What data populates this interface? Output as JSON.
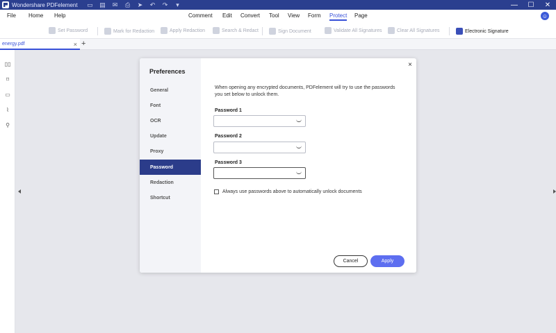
{
  "app": {
    "title": "Wondershare PDFelement"
  },
  "quick_access": [
    "folder-icon",
    "save-icon",
    "mail-icon",
    "print-icon",
    "send-icon",
    "undo-icon",
    "redo-icon",
    "dropdown-icon"
  ],
  "window_controls": {
    "minimize": "—",
    "maximize": "☐",
    "close": "✕"
  },
  "menu": {
    "file": "File",
    "home": "Home",
    "help": "Help",
    "comment": "Comment",
    "edit": "Edit",
    "convert": "Convert",
    "tool": "Tool",
    "view": "View",
    "form": "Form",
    "protect": "Protect",
    "page": "Page"
  },
  "toolbar": {
    "set_password": "Set Password",
    "mark_for_redaction": "Mark for Redaction",
    "apply_redaction": "Apply Redaction",
    "search_redact": "Search & Redact",
    "sign_document": "Sign Document",
    "validate_all": "Validate All Signatures",
    "clear_all": "Clear All Signatures",
    "electronic_signature": "Electronic Signature"
  },
  "tabs": {
    "document": "energy.pdf",
    "close": "×",
    "new": "+"
  },
  "dialog": {
    "title": "Preferences",
    "close": "×",
    "nav": [
      "General",
      "Font",
      "OCR",
      "Update",
      "Proxy",
      "Password",
      "Redaction",
      "Shortcut"
    ],
    "active_nav": "Password",
    "description": "When opening any encrypted documents, PDFelement will try to use the passwords you set below to unlock them.",
    "password1_label": "Password 1",
    "password2_label": "Password 2",
    "password3_label": "Password 3",
    "password1_value": "",
    "password2_value": "",
    "password3_value": "",
    "checkbox_label": "Always use passwords above to automatically unlock documents",
    "checkbox_checked": false,
    "cancel": "Cancel",
    "apply": "Apply"
  },
  "colors": {
    "titlebar": "#2b3f8f",
    "accent": "#3750d8",
    "nav_active": "#2b3c8a",
    "apply_button": "#5d6ef0"
  }
}
